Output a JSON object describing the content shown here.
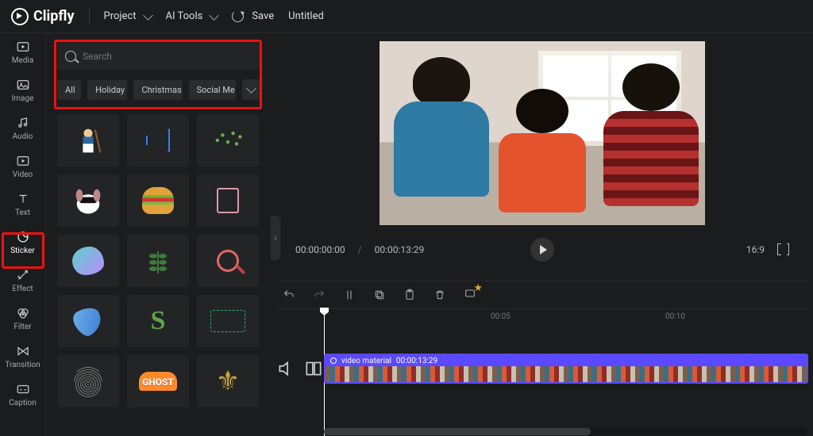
{
  "app": {
    "name": "Clipfly"
  },
  "topbar": {
    "project_label": "Project",
    "ai_tools_label": "AI Tools",
    "save_label": "Save",
    "title": "Untitled"
  },
  "leftrail": {
    "items": [
      {
        "id": "media",
        "label": "Media"
      },
      {
        "id": "image",
        "label": "Image"
      },
      {
        "id": "audio",
        "label": "Audio"
      },
      {
        "id": "video",
        "label": "Video"
      },
      {
        "id": "text",
        "label": "Text"
      },
      {
        "id": "sticker",
        "label": "Sticker",
        "active": true
      },
      {
        "id": "effect",
        "label": "Effect"
      },
      {
        "id": "filter",
        "label": "Filter"
      },
      {
        "id": "transition",
        "label": "Transition"
      },
      {
        "id": "caption",
        "label": "Caption"
      }
    ]
  },
  "panel": {
    "search_placeholder": "Search",
    "chips": [
      "All",
      "Holiday",
      "Christmas",
      "Social Me"
    ],
    "stickers": [
      "maid-cleaner",
      "speaker-outline",
      "sparkle-leaves",
      "cool-dog",
      "burger",
      "perfume",
      "blob",
      "leaf-sprig",
      "magnifier-red",
      "brush",
      "letter-s",
      "frame-dashed",
      "fingerprint",
      "ghost-text",
      "fleur-de-lis"
    ],
    "ghost_label": "GHOST"
  },
  "preview": {
    "current_time": "00:00:00:00",
    "total_time": "00:00:13:29",
    "aspect_ratio": "16:9"
  },
  "timeline": {
    "ruler_marks": [
      "00:05",
      "00:10"
    ],
    "clip": {
      "name": "video material",
      "duration": "00:00:13:29"
    }
  }
}
